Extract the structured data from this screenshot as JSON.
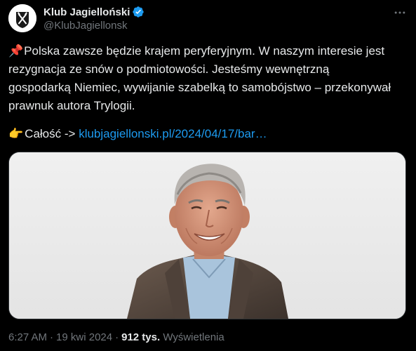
{
  "author": {
    "display_name": "Klub Jagielloński",
    "handle": "@KlubJagiellonsk",
    "avatar_icon": "crossed-swords-logo-icon",
    "verified_icon": "verified-badge-icon",
    "verified_color": "#1d9bf0"
  },
  "more_icon": "more-options-icon",
  "tweet": {
    "pin_emoji": "📌",
    "lines": [
      "Polska zawsze będzie krajem peryferyjnym. W naszym interesie jest",
      "rezygnacja ze snów o podmiotowości.  Jesteśmy wewnętrzną",
      "gospodarką Niemiec, wywijanie szabelką to samobójstwo – przekonywał",
      "prawnuk autora Trylogii."
    ],
    "hand_emoji": "👉",
    "link_prefix": "Całość ->",
    "link_text": "klubjagiellonski.pl/2024/04/17/bar…"
  },
  "media": {
    "image_icon": "portrait-photo-icon"
  },
  "meta": {
    "time": "6:27 AM",
    "separator": "·",
    "date": "19 kwi 2024",
    "separator2": "·",
    "views_count": "912 tys.",
    "views_label": "Wyświetlenia"
  },
  "colors": {
    "background": "#000000",
    "text": "#e7e9ea",
    "secondary": "#71767b",
    "link": "#1d9bf0"
  }
}
